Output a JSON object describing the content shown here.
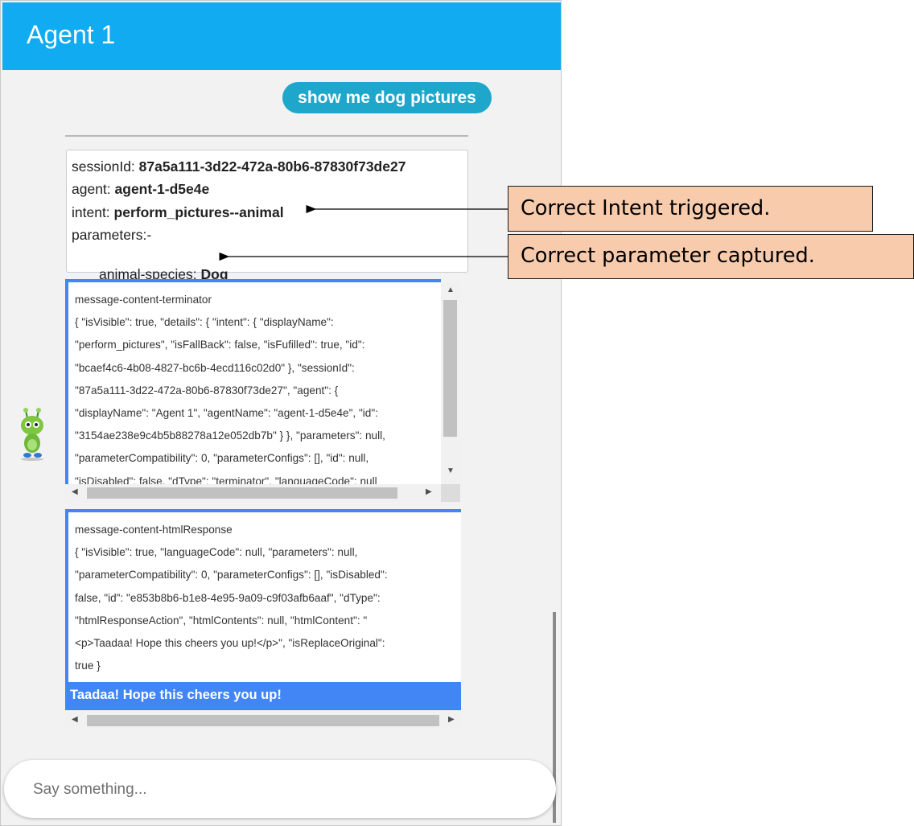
{
  "header": {
    "title": "Agent 1"
  },
  "user_message": "show me dog pictures",
  "session_info": {
    "session_label": "sessionId: ",
    "session_value": "87a5a111-3d22-472a-80b6-87830f73de27",
    "agent_label": "agent: ",
    "agent_value": "agent-1-d5e4e",
    "intent_label": "intent: ",
    "intent_value": "perform_pictures--animal",
    "parameters_label": "parameters:-",
    "param_label": " animal-species: ",
    "param_value": "Dog"
  },
  "message1": {
    "lines": [
      "message-content-terminator",
      "{ \"isVisible\": true, \"details\": { \"intent\": { \"displayName\":",
      "\"perform_pictures\", \"isFallBack\": false, \"isFufilled\": true, \"id\":",
      "\"bcaef4c6-4b08-4827-bc6b-4ecd116c02d0\" }, \"sessionId\":",
      "\"87a5a111-3d22-472a-80b6-87830f73de27\", \"agent\": {",
      "\"displayName\": \"Agent 1\", \"agentName\": \"agent-1-d5e4e\", \"id\":",
      "\"3154ae238e9c4b5b88278a12e052db7b\" } }, \"parameters\": null,",
      "\"parameterCompatibility\": 0, \"parameterConfigs\": [], \"id\": null,",
      "\"isDisabled\": false, \"dType\": \"terminator\", \"languageCode\": null"
    ]
  },
  "message2": {
    "lines": [
      "message-content-htmlResponse",
      "{ \"isVisible\": true, \"languageCode\": null, \"parameters\": null,",
      "\"parameterCompatibility\": 0, \"parameterConfigs\": [], \"isDisabled\":",
      "false, \"id\": \"e853b8b6-b1e8-4e95-9a09-c9f03afb6aaf\", \"dType\":",
      "\"htmlResponseAction\", \"htmlContents\": null, \"htmlContent\": \"",
      "<p>Taadaa! Hope this cheers you up!</p>\", \"isReplaceOriginal\":",
      "true }"
    ],
    "rendered_html": "Taadaa! Hope this cheers you up!"
  },
  "input": {
    "placeholder": "Say something..."
  },
  "callouts": {
    "intent": "Correct Intent triggered.",
    "parameter": "Correct parameter captured."
  },
  "colors": {
    "header": "#10abf0",
    "user_bubble": "#1fa7cb",
    "message_accent": "#4285f4",
    "callout_fill": "#f8cbad"
  }
}
